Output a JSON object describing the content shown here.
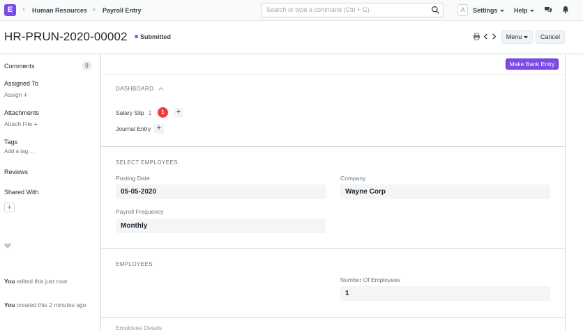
{
  "navbar": {
    "logo_letter": "E",
    "breadcrumbs": [
      "Human Resources",
      "Payroll Entry"
    ],
    "search_placeholder": "Search or type a command (Ctrl + G)",
    "avatar_letter": "A",
    "settings_label": "Settings",
    "help_label": "Help"
  },
  "page_head": {
    "title": "HR-PRUN-2020-00002",
    "status": "Submitted",
    "status_color": "#5e64ff",
    "menu_label": "Menu",
    "cancel_label": "Cancel"
  },
  "sidebar": {
    "comments_label": "Comments",
    "comments_count": "0",
    "assigned_to_label": "Assigned To",
    "assign_link": "Assign",
    "attachments_label": "Attachments",
    "attach_link": "Attach File",
    "tags_label": "Tags",
    "add_tag_link": "Add a tag ...",
    "reviews_label": "Reviews",
    "shared_with_label": "Shared With",
    "activity": [
      {
        "who": "You",
        "text": "edited this just now"
      },
      {
        "who": "You",
        "text": "created this 2 minutes ago"
      }
    ]
  },
  "main": {
    "make_bank_entry_label": "Make Bank Entry",
    "accent_color": "#7b4be8",
    "dashboard": {
      "heading": "DASHBOARD",
      "items": [
        {
          "label": "Salary Slip",
          "count": "1",
          "open_count": "1"
        },
        {
          "label": "Journal Entry"
        }
      ]
    },
    "select_employees": {
      "heading": "SELECT EMPLOYEES",
      "posting_date_label": "Posting Date",
      "posting_date_value": "05-05-2020",
      "company_label": "Company",
      "company_value": "Wayne Corp",
      "payroll_frequency_label": "Payroll Frequency",
      "payroll_frequency_value": "Monthly"
    },
    "employees": {
      "heading": "EMPLOYEES",
      "number_label": "Number Of Employees",
      "number_value": "1",
      "next_section_label": "Employee Details"
    }
  }
}
